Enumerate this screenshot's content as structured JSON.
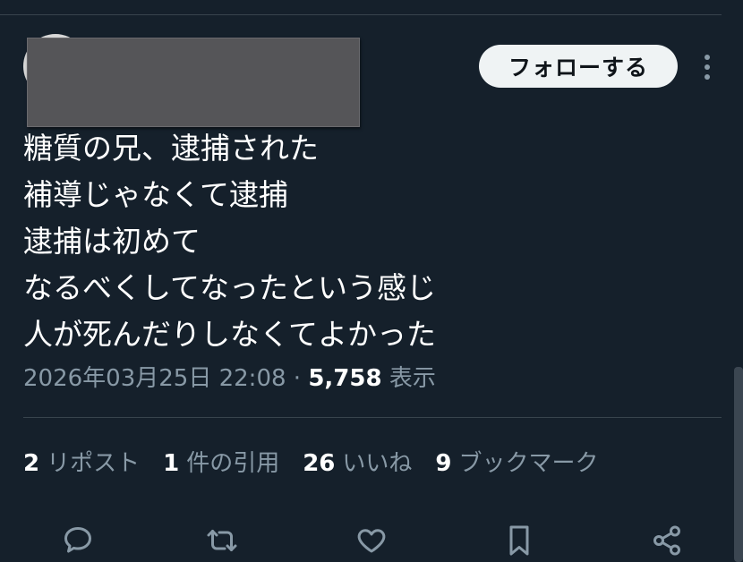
{
  "header": {
    "follow_label": "フォローする"
  },
  "tweet": {
    "lines": [
      "糖質の兄、逮捕された",
      "補導じゃなくて逮捕",
      "逮捕は初めて",
      "なるべくしてなったという感じ",
      "人が死んだりしなくてよかった"
    ],
    "timestamp": "2026年03月25日 22:08",
    "separator": "·",
    "views_count": "5,758",
    "views_label": "表示"
  },
  "stats": {
    "reposts": {
      "count": "2",
      "label": "リポスト"
    },
    "quotes": {
      "count": "1",
      "label": "件の引用"
    },
    "likes": {
      "count": "26",
      "label": "いいね"
    },
    "bookmarks": {
      "count": "9",
      "label": "ブックマーク"
    }
  },
  "actions": {
    "icons": [
      "reply-icon",
      "repost-icon",
      "like-icon",
      "bookmark-icon",
      "share-icon"
    ]
  },
  "colors": {
    "background": "#15202b",
    "divider": "#38444d",
    "secondary_text": "#8899a6",
    "follow_button_bg": "#eff3f4",
    "icon": "#8899a6"
  }
}
